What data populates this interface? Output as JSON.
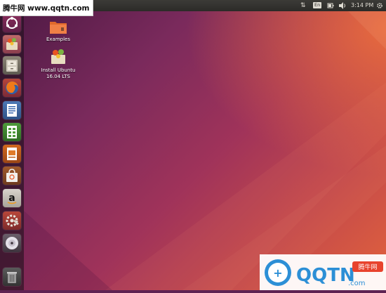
{
  "watermark_top": {
    "text": "腾牛网 www.qqtn.com"
  },
  "watermark_bottom": {
    "logo_text": "QQTN",
    "suffix": ".com",
    "badge": "腾牛网"
  },
  "top_bar": {
    "time": "3:14 PM",
    "keyboard_layout": "En",
    "indicators": [
      "transfer-arrows-icon",
      "keyboard-layout-indicator",
      "battery-icon",
      "volume-icon",
      "clock",
      "gear-icon"
    ]
  },
  "launcher": {
    "items": [
      {
        "name": "ubuntu-dash-button",
        "icon": "ubuntu-logo-icon"
      },
      {
        "name": "install-ubuntu-launcher",
        "icon": "installer-icon"
      },
      {
        "name": "files-launcher",
        "icon": "file-cabinet-icon"
      },
      {
        "name": "firefox-launcher",
        "icon": "firefox-icon"
      },
      {
        "name": "libreoffice-writer-launcher",
        "icon": "writer-icon"
      },
      {
        "name": "libreoffice-calc-launcher",
        "icon": "calc-icon"
      },
      {
        "name": "libreoffice-impress-launcher",
        "icon": "impress-icon"
      },
      {
        "name": "ubuntu-software-launcher",
        "icon": "shopping-bag-icon"
      },
      {
        "name": "amazon-launcher",
        "icon": "amazon-icon"
      },
      {
        "name": "system-settings-launcher",
        "icon": "settings-icon"
      },
      {
        "name": "dvd-launcher",
        "icon": "disc-icon"
      },
      {
        "name": "trash-launcher",
        "icon": "trash-icon"
      }
    ]
  },
  "desktop": {
    "icons": [
      {
        "label": "Examples"
      },
      {
        "label": "Install Ubuntu",
        "sublabel": "16.04 LTS"
      }
    ]
  },
  "colors": {
    "launcher_bg": "#2a1224",
    "panel_bg": "#3c3b37",
    "ubuntu_orange": "#e95420",
    "wallpaper_purple": "#5e2252"
  }
}
